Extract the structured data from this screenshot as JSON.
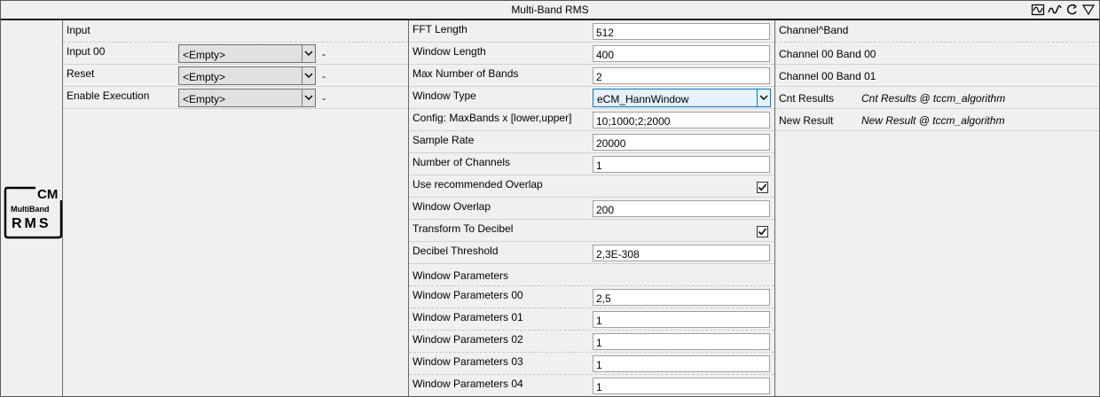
{
  "window": {
    "title": "Multi-Band RMS"
  },
  "title_icons": [
    "signal-icon",
    "wave-icon",
    "refresh-icon",
    "collapse-icon"
  ],
  "module_icon": {
    "text_cm": "CM",
    "text_top": "MultiBand",
    "text_bottom": "RMS"
  },
  "inputs": {
    "header": "Input",
    "rows": [
      {
        "label": "Input 00",
        "value": "<Empty>",
        "suffix": "-"
      },
      {
        "label": "Reset",
        "value": "<Empty>",
        "suffix": "-"
      },
      {
        "label": "Enable Execution",
        "value": "<Empty>",
        "suffix": "-"
      }
    ]
  },
  "params": {
    "fft_length": {
      "label": "FFT Length",
      "value": "512"
    },
    "window_length": {
      "label": "Window Length",
      "value": "400"
    },
    "max_bands": {
      "label": "Max Number of Bands",
      "value": "2"
    },
    "window_type": {
      "label": "Window Type",
      "value": "eCM_HannWindow"
    },
    "config_bands": {
      "label": "Config: MaxBands x [lower,upper]",
      "value": "10;1000;2;2000"
    },
    "sample_rate": {
      "label": "Sample Rate",
      "value": "20000"
    },
    "num_channels": {
      "label": "Number of Channels",
      "value": "1"
    },
    "use_overlap": {
      "label": "Use recommended Overlap",
      "checked": true
    },
    "window_overlap": {
      "label": "Window Overlap",
      "value": "200"
    },
    "to_decibel": {
      "label": "Transform To Decibel",
      "checked": true
    },
    "decibel_threshold": {
      "label": "Decibel Threshold",
      "value": "2,3E-308"
    },
    "window_parameters_header": "Window Parameters",
    "window_parameters": [
      {
        "label": "Window Parameters 00",
        "value": "2,5"
      },
      {
        "label": "Window Parameters 01",
        "value": "1"
      },
      {
        "label": "Window Parameters 02",
        "value": "1"
      },
      {
        "label": "Window Parameters 03",
        "value": "1"
      },
      {
        "label": "Window Parameters 04",
        "value": "1"
      }
    ]
  },
  "outputs": {
    "header": "Channel^Band",
    "rows": [
      {
        "label": "Channel 00 Band 00",
        "value": ""
      },
      {
        "label": "Channel 00 Band 01",
        "value": ""
      },
      {
        "label": "Cnt Results",
        "value": "Cnt Results @ tccm_algorithm"
      },
      {
        "label": "New Result",
        "value": "New Result @ tccm_algorithm"
      }
    ]
  }
}
